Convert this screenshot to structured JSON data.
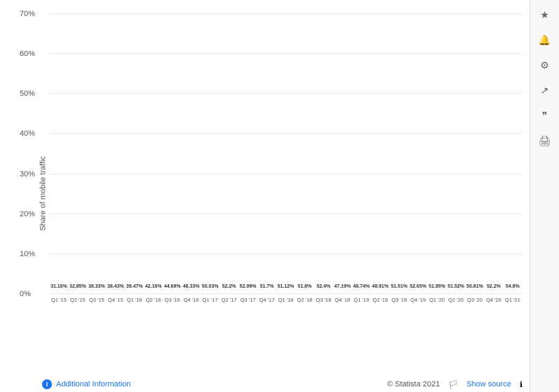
{
  "title": "",
  "yAxisLabel": "Share of mobile traffic",
  "sidebar": {
    "icons": [
      "star",
      "bell",
      "gear",
      "share",
      "quote",
      "print"
    ]
  },
  "yAxis": {
    "labels": [
      "0%",
      "10%",
      "20%",
      "30%",
      "40%",
      "50%",
      "60%",
      "70%"
    ],
    "max": 70
  },
  "bars": [
    {
      "label": "31.16%",
      "value": 31.16,
      "xLabel": "Q1 '15"
    },
    {
      "label": "32.85%",
      "value": 32.85,
      "xLabel": "Q2 '15"
    },
    {
      "label": "38.33%",
      "value": 38.33,
      "xLabel": "Q3 '15"
    },
    {
      "label": "38.43%",
      "value": 38.43,
      "xLabel": "Q4 '15"
    },
    {
      "label": "39.47%",
      "value": 39.47,
      "xLabel": "Q1 '16"
    },
    {
      "label": "42.16%",
      "value": 42.16,
      "xLabel": "Q2 '16"
    },
    {
      "label": "44.69%",
      "value": 44.69,
      "xLabel": "Q3 '16"
    },
    {
      "label": "48.33%",
      "value": 48.33,
      "xLabel": "Q4 '16"
    },
    {
      "label": "50.03%",
      "value": 50.03,
      "xLabel": "Q1 '17"
    },
    {
      "label": "52.2%",
      "value": 52.2,
      "xLabel": "Q2 '17"
    },
    {
      "label": "52.99%",
      "value": 52.99,
      "xLabel": "Q3 '17"
    },
    {
      "label": "51.7%",
      "value": 51.7,
      "xLabel": "Q4 '17"
    },
    {
      "label": "51.12%",
      "value": 51.12,
      "xLabel": "Q1 '18"
    },
    {
      "label": "51.8%",
      "value": 51.8,
      "xLabel": "Q2 '18"
    },
    {
      "label": "52.4%",
      "value": 52.4,
      "xLabel": "Q3 '18"
    },
    {
      "label": "47.19%",
      "value": 47.19,
      "xLabel": "Q4 '18"
    },
    {
      "label": "48.74%",
      "value": 48.74,
      "xLabel": "Q1 '19"
    },
    {
      "label": "48.91%",
      "value": 48.91,
      "xLabel": "Q2 '19"
    },
    {
      "label": "51.51%",
      "value": 51.51,
      "xLabel": "Q3 '19"
    },
    {
      "label": "52.65%",
      "value": 52.65,
      "xLabel": "Q4 '19"
    },
    {
      "label": "51.95%",
      "value": 51.95,
      "xLabel": "Q1 '20"
    },
    {
      "label": "51.52%",
      "value": 51.52,
      "xLabel": "Q2 '20"
    },
    {
      "label": "50.81%",
      "value": 50.81,
      "xLabel": "Q3 '20"
    },
    {
      "label": "52.2%",
      "value": 52.2,
      "xLabel": "Q4 '20"
    },
    {
      "label": "54.8%",
      "value": 54.8,
      "xLabel": "Q1 '21"
    }
  ],
  "footer": {
    "additionalInfo": "Additional Information",
    "showSource": "Show source",
    "statista": "© Statista 2021"
  }
}
